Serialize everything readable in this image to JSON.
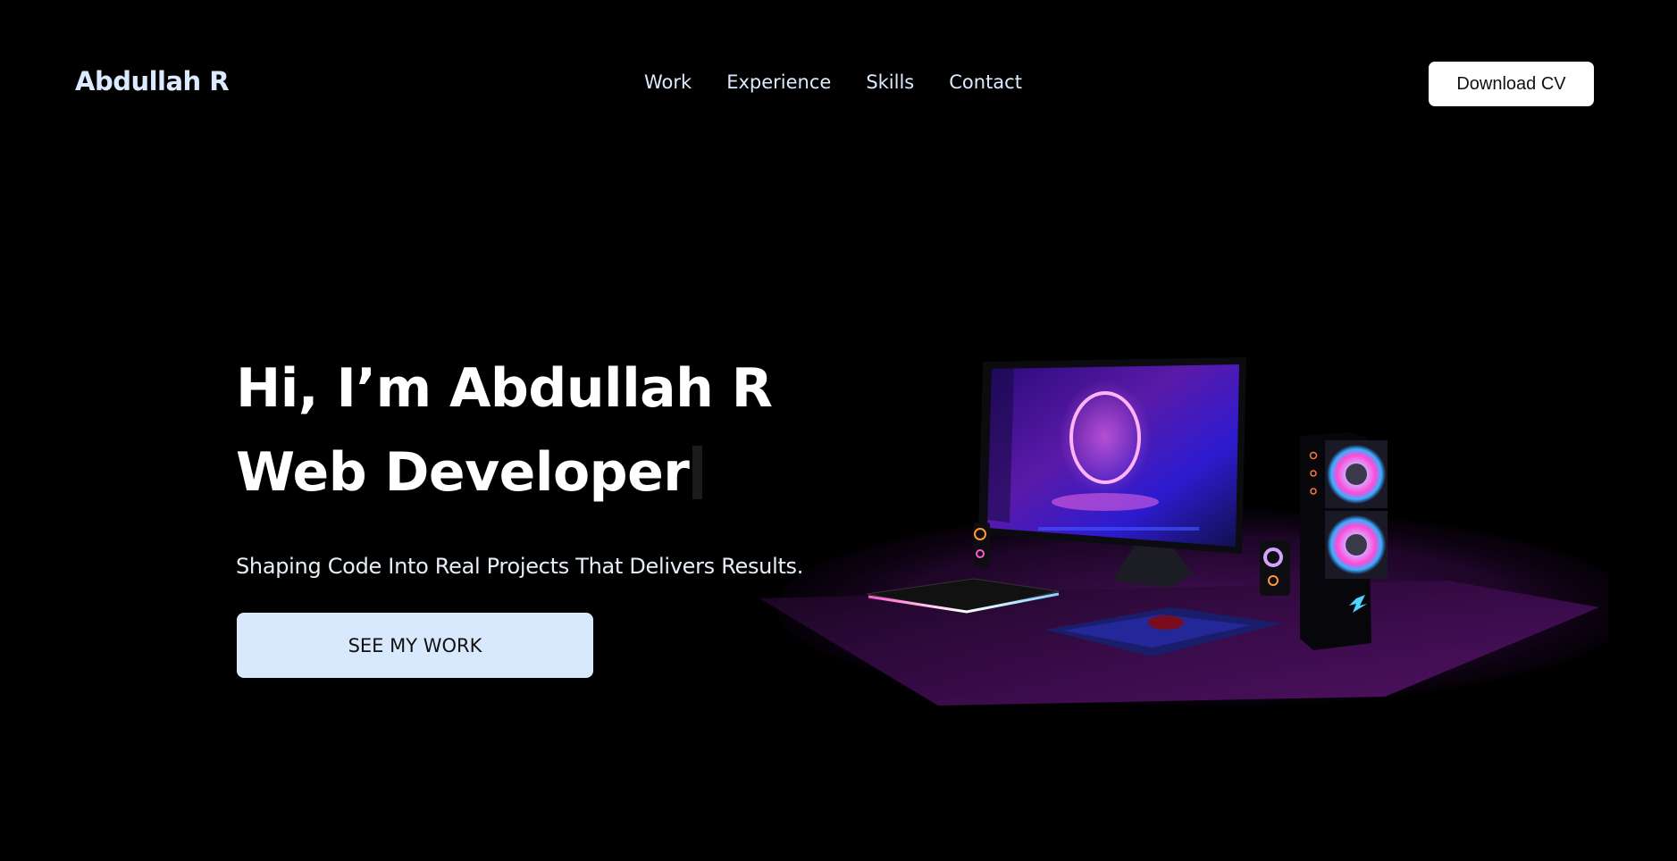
{
  "header": {
    "logo": "Abdullah R",
    "nav": [
      {
        "label": "Work"
      },
      {
        "label": "Experience"
      },
      {
        "label": "Skills"
      },
      {
        "label": "Contact"
      }
    ],
    "download_label": "Download CV"
  },
  "hero": {
    "line1": "Hi, I’m Abdullah R",
    "line2": "Web Developer",
    "tagline": "Shaping Code Into Real Projects That Delivers Results.",
    "cta_label": "SEE MY WORK"
  },
  "colors": {
    "background": "#000000",
    "logo": "#dbeafe",
    "cta_bg": "#d9e9fd",
    "download_bg": "#ffffff",
    "accent_magenta": "#ff3ee0",
    "accent_blue": "#4a3bff",
    "desk_purple": "#3a0a4a"
  },
  "illustration": {
    "icon": "desk-setup-illustration"
  }
}
